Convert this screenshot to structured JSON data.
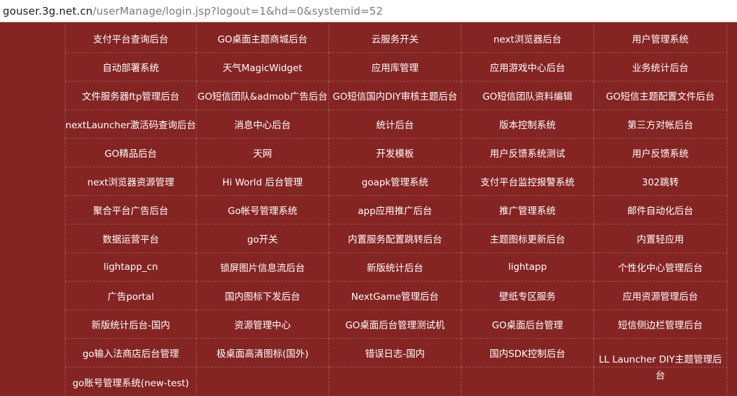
{
  "address_bar": {
    "domain": "gouser.3g.net.cn",
    "path": "/userManage/login.jsp?logout=1&hd=0&systemid=52"
  },
  "systems": [
    [
      "支付平台查询后台",
      "GO桌面主题商城后台",
      "云服务开关",
      "next浏览器后台",
      "用户管理系统"
    ],
    [
      "自动部署系统",
      "天气MagicWidget",
      "应用库管理",
      "应用游戏中心后台",
      "业务统计后台"
    ],
    [
      "文件服务器ftp管理后台",
      "GO短信团队&admob广告后台",
      "GO短信国内DIY审核主题后台",
      "GO短信团队资料编辑",
      "GO短信主题配置文件后台"
    ],
    [
      "nextLauncher激活码查询后台",
      "消息中心后台",
      "统计后台",
      "版本控制系统",
      "第三方对帐后台"
    ],
    [
      "GO精品后台",
      "天网",
      "开发模板",
      "用户反馈系统测试",
      "用户反馈系统"
    ],
    [
      "next浏览器资源管理",
      "Hi World 后台管理",
      "goapk管理系统",
      "支付平台监控报警系统",
      "302跳转"
    ],
    [
      "聚合平台广告后台",
      "Go帐号管理系统",
      "app应用推广后台",
      "推广管理系统",
      "邮件自动化后台"
    ],
    [
      "数据运营平台",
      "go开关",
      "内置服务配置跳转后台",
      "主题图标更新后台",
      "内置轻应用"
    ],
    [
      "lightapp_cn",
      "锁屏图片信息流后台",
      "新版统计后台",
      "lightapp",
      "个性化中心管理后台"
    ],
    [
      "广告portal",
      "国内图标下发后台",
      "NextGame管理后台",
      "壁纸专区服务",
      "应用资源管理后台"
    ],
    [
      "新版统计后台-国内",
      "资源管理中心",
      "GO桌面后台管理测试机",
      "GO桌面后台管理",
      "短信侧边栏管理后台"
    ],
    [
      "go输入法商店后台管理",
      "极桌面高清图标(国外)",
      "错误日志-国内",
      "国内SDK控制后台",
      "LL Launcher DIY主题管理后"
    ],
    [
      "go账号管理系统(new-test)",
      "",
      "",
      "",
      "台"
    ]
  ],
  "colors": {
    "background": "#842523",
    "grid_line": "#9e5250",
    "text": "#ffffff"
  }
}
